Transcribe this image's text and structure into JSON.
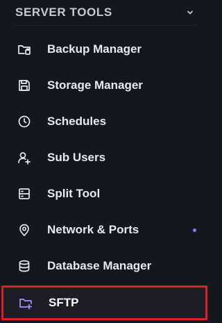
{
  "section": {
    "title": "SERVER TOOLS",
    "chevron_icon": "chevron-down-icon"
  },
  "menu": {
    "items": [
      {
        "label": "Backup Manager",
        "icon": "folder-backup-icon"
      },
      {
        "label": "Storage Manager",
        "icon": "save-disk-icon"
      },
      {
        "label": "Schedules",
        "icon": "clock-icon"
      },
      {
        "label": "Sub Users",
        "icon": "user-plus-icon"
      },
      {
        "label": "Split Tool",
        "icon": "split-layout-icon"
      },
      {
        "label": "Network & Ports",
        "icon": "location-pin-icon",
        "has_dot": true
      },
      {
        "label": "Database Manager",
        "icon": "database-icon"
      },
      {
        "label": "SFTP",
        "icon": "folder-plus-icon",
        "active": true
      }
    ]
  },
  "colors": {
    "background": "#15171e",
    "text": "#e8e9ee",
    "accent": "#8b7bf0",
    "highlight_border": "#e11d22"
  }
}
